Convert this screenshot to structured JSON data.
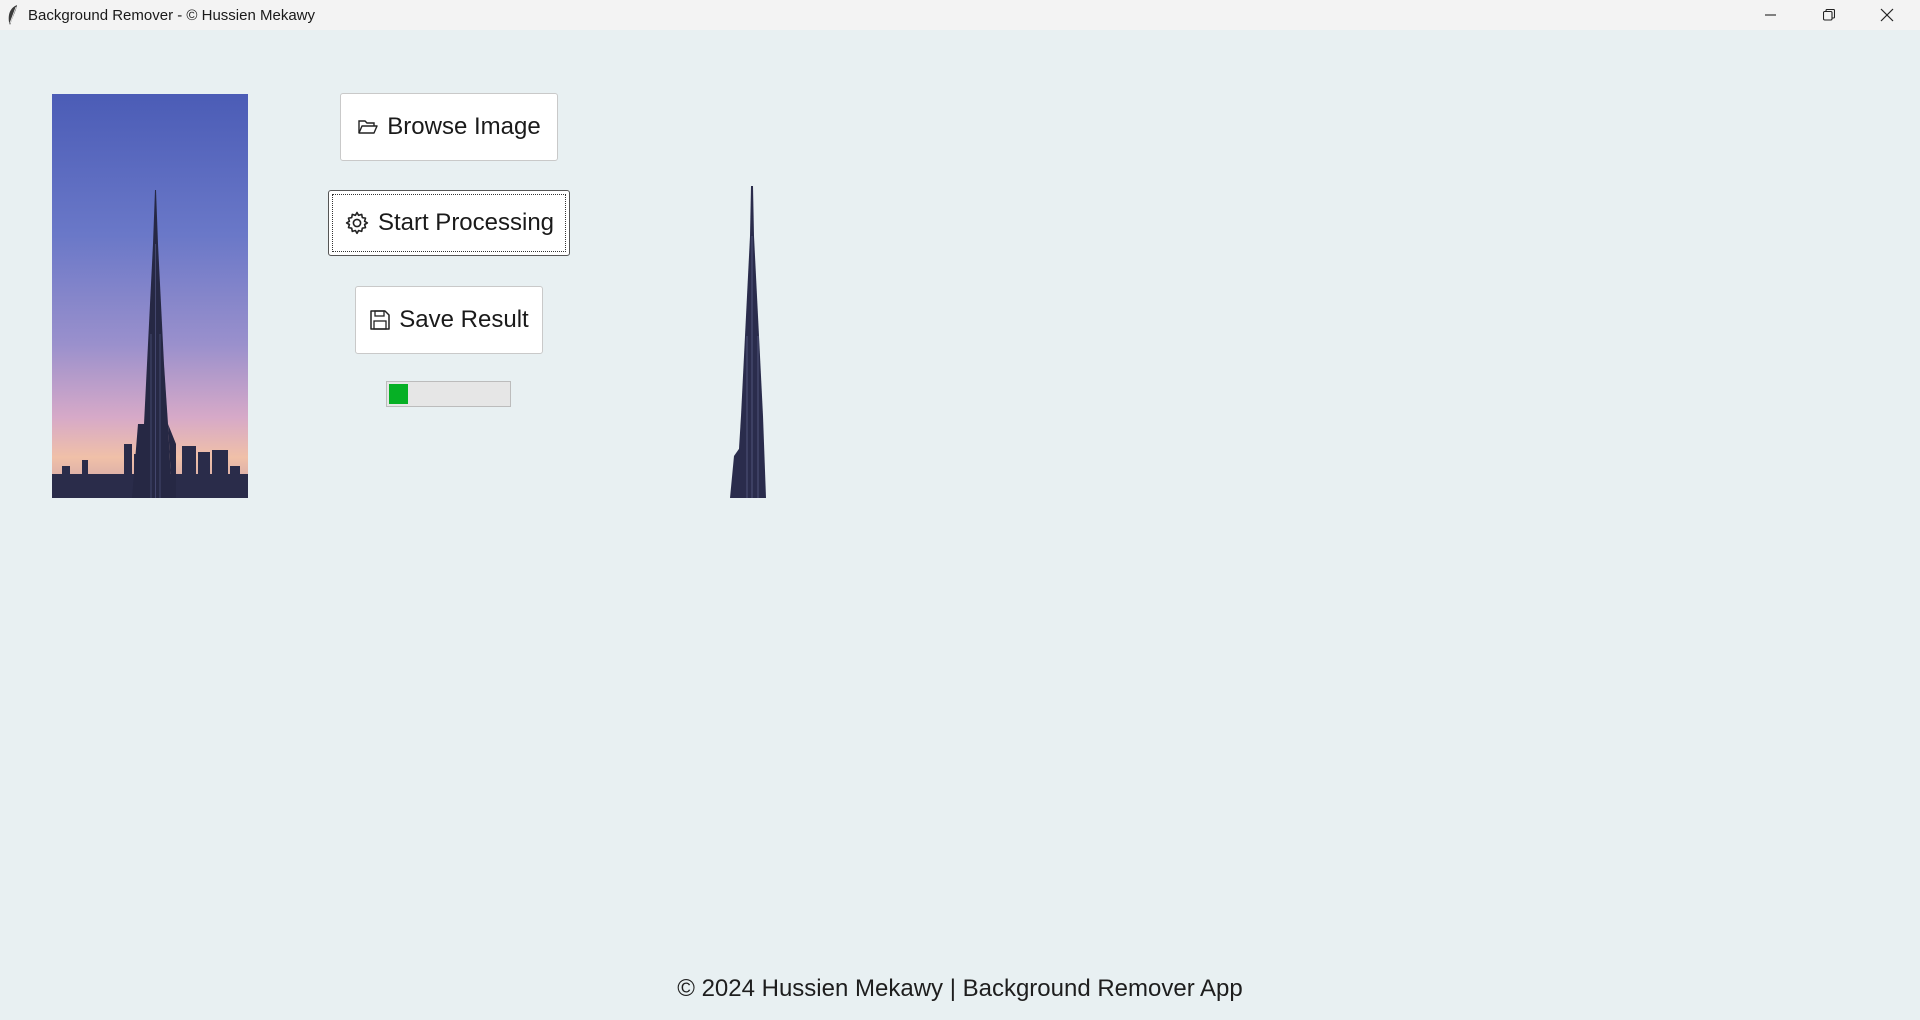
{
  "window": {
    "title": "Background Remover - © Hussien Mekawy",
    "controls": {
      "minimize_icon": "minimize-icon",
      "maximize_icon": "restore-icon",
      "close_icon": "close-icon"
    }
  },
  "toolbar": {
    "browse_label": "Browse Image",
    "browse_icon": "folder-open-icon",
    "start_label": "Start Processing",
    "start_icon": "gear-icon",
    "save_label": "Save Result",
    "save_icon": "floppy-disk-icon"
  },
  "progress": {
    "fraction": 0.16,
    "color": "#06b025"
  },
  "colors": {
    "background": "#e8f0f2",
    "sky_top": "#4b5fb8",
    "sky_bottom": "#e9b8c4"
  },
  "footer": {
    "text": "© 2024 Hussien Mekawy | Background Remover App"
  }
}
